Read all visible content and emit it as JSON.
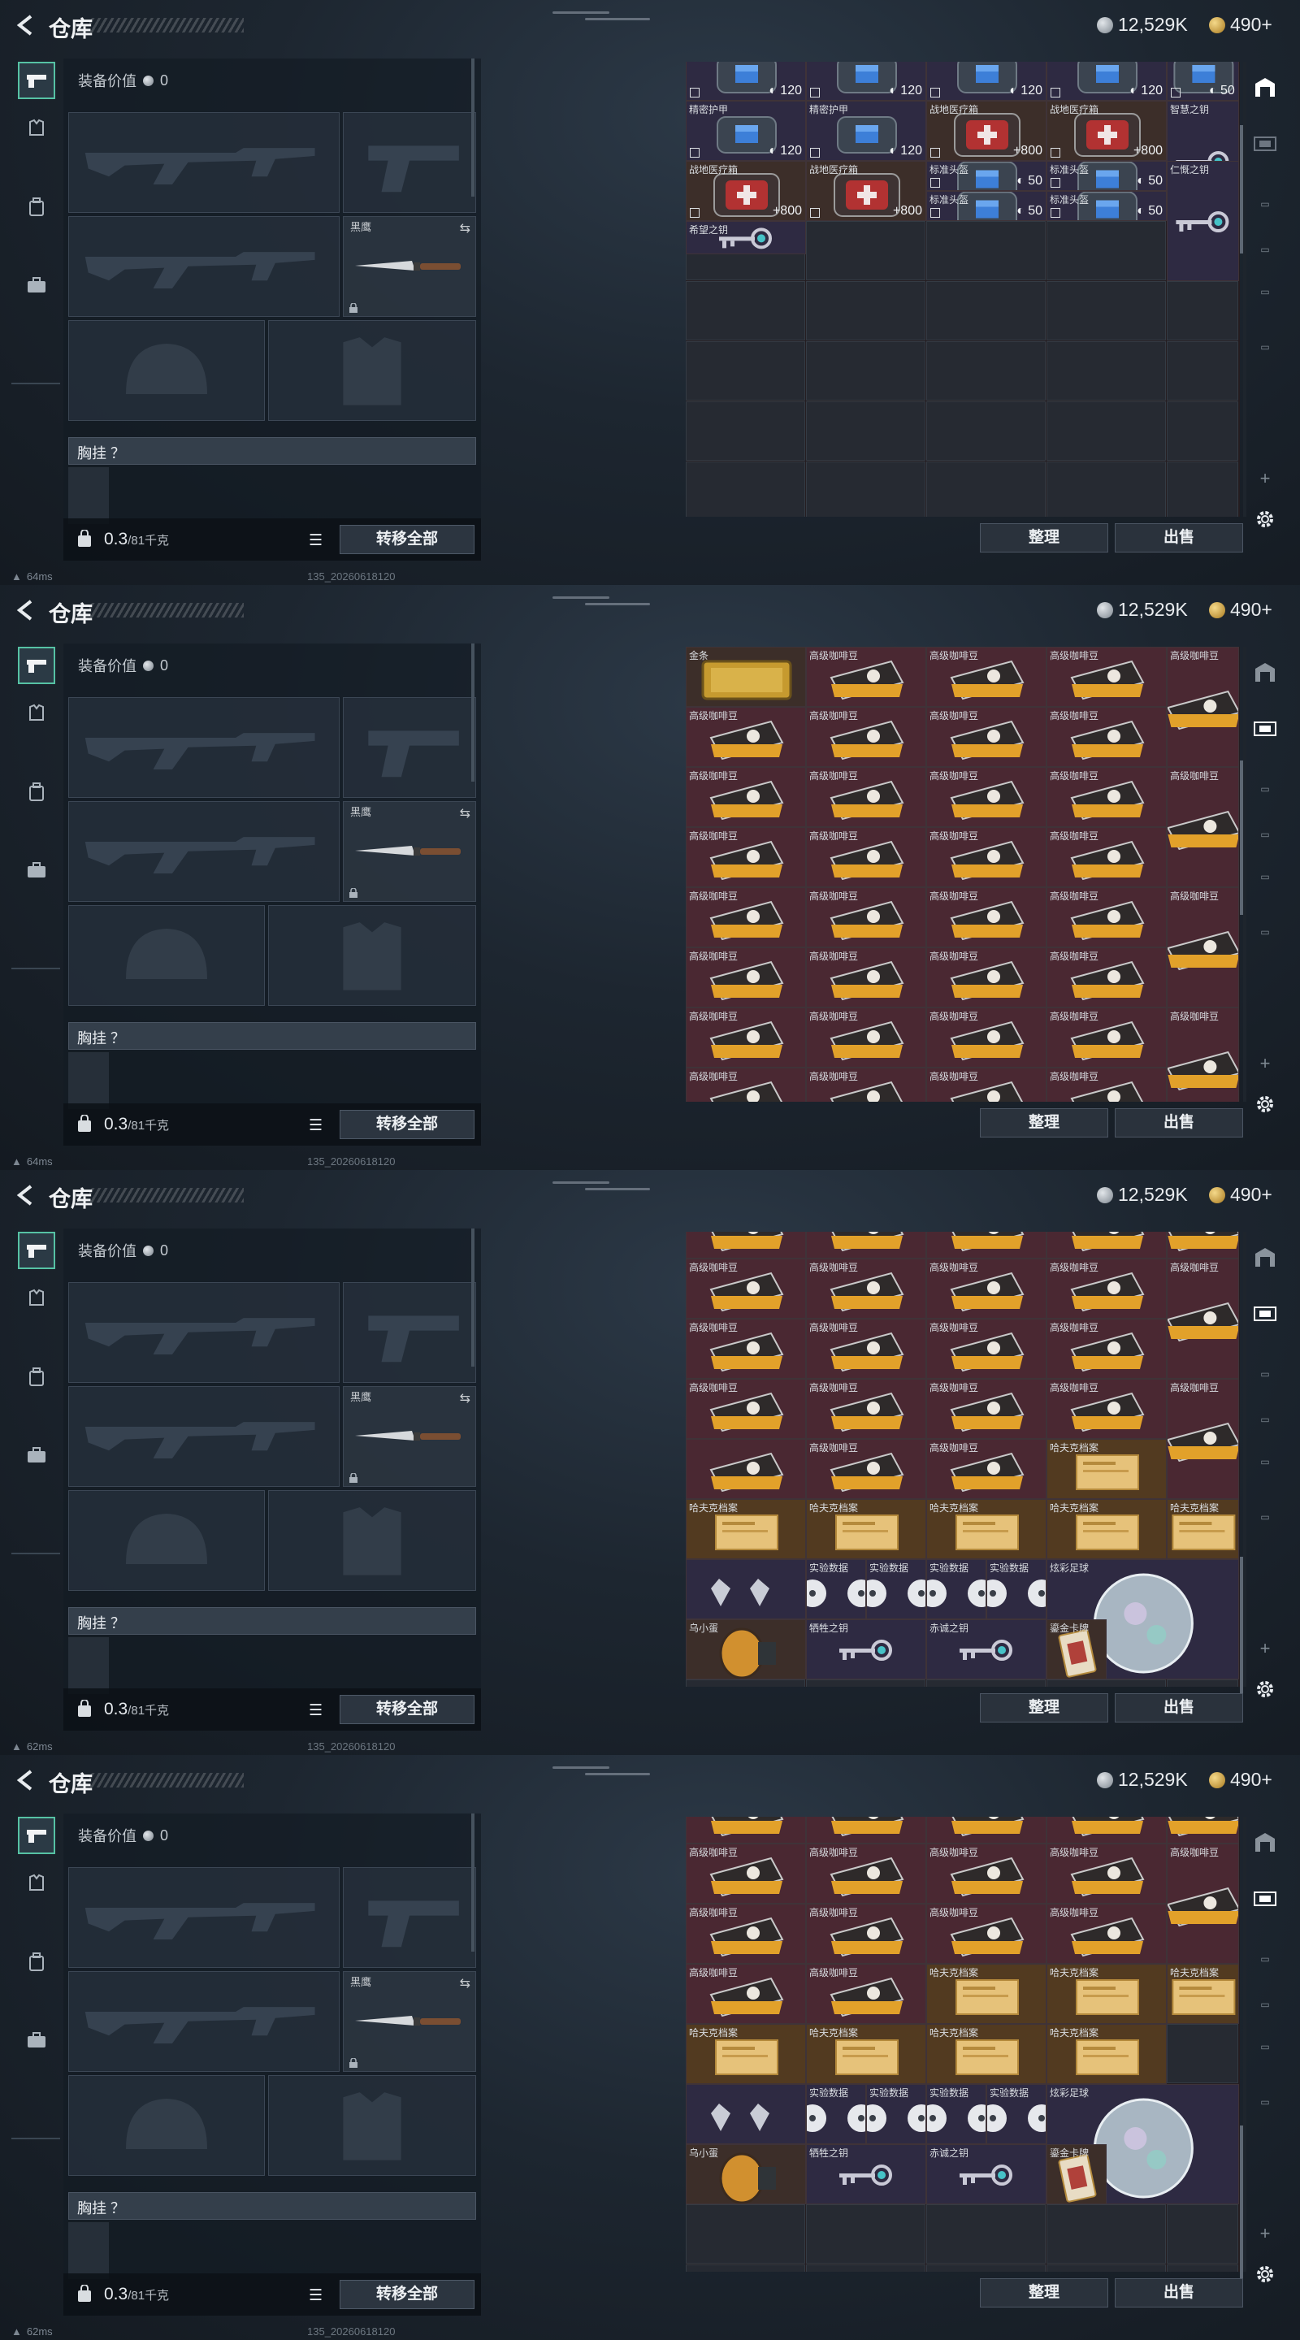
{
  "app": {
    "title": "仓库",
    "currency_silver": "12,529K",
    "currency_gold": "490+",
    "equipment_value_label": "装备价值",
    "equipment_value": "0",
    "knife_label": "黑鹰",
    "chest_rig_label": "胸挂 ？",
    "weight_value": "0.3",
    "weight_unit": "/81千克",
    "transfer_all_label": "转移全部",
    "sort_label": "整理",
    "sell_label": "出售",
    "build_id": "135_20260618120"
  },
  "colors": {
    "accent": "#56c2a4",
    "cell_purple": "#2e2a42",
    "cell_brown": "#3c2e29",
    "cell_maroon": "#4a2832",
    "cell_amber": "#523a20",
    "cell_dark": "#232a34"
  },
  "panels": [
    {
      "ping": "64ms",
      "cells": [
        {
          "label": "",
          "value": "120",
          "kind": "shield",
          "icon": "armor-case-icon"
        },
        {
          "label": "",
          "value": "120",
          "kind": "shield",
          "icon": "armor-case-icon"
        },
        {
          "label": "",
          "value": "120",
          "kind": "shield",
          "icon": "armor-case-icon"
        },
        {
          "label": "",
          "value": "120",
          "kind": "shield",
          "icon": "armor-case-icon"
        },
        {
          "label": "",
          "value": "50",
          "kind": "shield",
          "icon": "helmet-case-icon"
        },
        {
          "label": "精密护甲",
          "value": "120",
          "kind": "shield",
          "icon": "armor-case-icon"
        },
        {
          "label": "精密护甲",
          "value": "120",
          "kind": "shield",
          "icon": "armor-case-icon"
        },
        {
          "label": "战地医疗箱",
          "value": "+800",
          "kind": "heal",
          "icon": "medkit-icon"
        },
        {
          "label": "战地医疗箱",
          "value": "+800",
          "kind": "heal",
          "icon": "medkit-icon"
        },
        {
          "label": "智慧之钥",
          "value": "",
          "kind": "key",
          "icon": "key-icon"
        },
        {
          "label": "战地医疗箱",
          "value": "+800",
          "kind": "heal",
          "icon": "medkit-icon"
        },
        {
          "label": "战地医疗箱",
          "value": "+800",
          "kind": "heal",
          "icon": "medkit-icon"
        },
        {
          "label": "标准头盔",
          "value": "50",
          "kind": "shield",
          "icon": "helmet-case-icon"
        },
        {
          "label": "标准头盔",
          "value": "50",
          "kind": "shield",
          "icon": "helmet-case-icon"
        },
        {
          "label": "仁慨之钥",
          "value": "",
          "kind": "key",
          "icon": "key-icon"
        },
        {
          "label": "标准头盔",
          "value": "50",
          "kind": "shield",
          "icon": "helmet-case-icon"
        },
        {
          "label": "标准头盔",
          "value": "50",
          "kind": "shield",
          "icon": "helmet-case-icon"
        },
        {
          "label": "希望之钥",
          "value": "",
          "kind": "key",
          "icon": "key-icon"
        }
      ]
    },
    {
      "ping": "64ms",
      "cells": [
        {
          "label": "金条",
          "value": "",
          "kind": "gold",
          "icon": "gold-bar-icon"
        },
        {
          "label": "高级咖啡豆",
          "value": "",
          "kind": "coffee",
          "icon": "coffee-box-icon"
        },
        {
          "label": "高级咖啡豆",
          "value": "",
          "kind": "coffee",
          "icon": "coffee-box-icon"
        },
        {
          "label": "高级咖啡豆",
          "value": "",
          "kind": "coffee",
          "icon": "coffee-box-icon"
        },
        {
          "label": "高级咖啡豆",
          "value": "",
          "kind": "coffee",
          "icon": "coffee-bag-icon"
        },
        {
          "label": "高级咖啡豆",
          "value": "",
          "kind": "coffee",
          "icon": "coffee-box-icon"
        },
        {
          "label": "高级咖啡豆",
          "value": "",
          "kind": "coffee",
          "icon": "coffee-box-icon"
        },
        {
          "label": "高级咖啡豆",
          "value": "",
          "kind": "coffee",
          "icon": "coffee-box-icon"
        },
        {
          "label": "高级咖啡豆",
          "value": "",
          "kind": "coffee",
          "icon": "coffee-box-icon"
        },
        {
          "label": "高级咖啡豆",
          "value": "",
          "kind": "coffee",
          "icon": "coffee-box-icon"
        },
        {
          "label": "高级咖啡豆",
          "value": "",
          "kind": "coffee",
          "icon": "coffee-box-icon"
        },
        {
          "label": "高级咖啡豆",
          "value": "",
          "kind": "coffee",
          "icon": "coffee-box-icon"
        },
        {
          "label": "高级咖啡豆",
          "value": "",
          "kind": "coffee",
          "icon": "coffee-box-icon"
        },
        {
          "label": "高级咖啡豆",
          "value": "",
          "kind": "coffee",
          "icon": "coffee-bag-icon"
        },
        {
          "label": "高级咖啡豆",
          "value": "",
          "kind": "coffee",
          "icon": "coffee-box-icon"
        },
        {
          "label": "高级咖啡豆",
          "value": "",
          "kind": "coffee",
          "icon": "coffee-box-icon"
        },
        {
          "label": "高级咖啡豆",
          "value": "",
          "kind": "coffee",
          "icon": "coffee-box-icon"
        },
        {
          "label": "高级咖啡豆",
          "value": "",
          "kind": "coffee",
          "icon": "coffee-box-icon"
        },
        {
          "label": "高级咖啡豆",
          "value": "",
          "kind": "coffee",
          "icon": "coffee-box-icon"
        },
        {
          "label": "高级咖啡豆",
          "value": "",
          "kind": "coffee",
          "icon": "coffee-box-icon"
        },
        {
          "label": "高级咖啡豆",
          "value": "",
          "kind": "coffee",
          "icon": "coffee-box-icon"
        },
        {
          "label": "高级咖啡豆",
          "value": "",
          "kind": "coffee",
          "icon": "coffee-box-icon"
        },
        {
          "label": "高级咖啡豆",
          "value": "",
          "kind": "coffee",
          "icon": "coffee-bag-icon"
        },
        {
          "label": "高级咖啡豆",
          "value": "",
          "kind": "coffee",
          "icon": "coffee-box-icon"
        },
        {
          "label": "高级咖啡豆",
          "value": "",
          "kind": "coffee",
          "icon": "coffee-box-icon"
        },
        {
          "label": "高级咖啡豆",
          "value": "",
          "kind": "coffee",
          "icon": "coffee-box-icon"
        },
        {
          "label": "高级咖啡豆",
          "value": "",
          "kind": "coffee",
          "icon": "coffee-box-icon"
        },
        {
          "label": "高级咖啡豆",
          "value": "",
          "kind": "coffee",
          "icon": "coffee-box-icon"
        },
        {
          "label": "高级咖啡豆",
          "value": "",
          "kind": "coffee",
          "icon": "coffee-box-icon"
        },
        {
          "label": "高级咖啡豆",
          "value": "",
          "kind": "coffee",
          "icon": "coffee-box-icon"
        },
        {
          "label": "高级咖啡豆",
          "value": "",
          "kind": "coffee",
          "icon": "coffee-bag-icon"
        },
        {
          "label": "高级咖啡豆",
          "value": "",
          "kind": "coffee",
          "icon": "coffee-box-icon"
        },
        {
          "label": "高级咖啡豆",
          "value": "",
          "kind": "coffee",
          "icon": "coffee-box-icon"
        },
        {
          "label": "高级咖啡豆",
          "value": "",
          "kind": "coffee",
          "icon": "coffee-box-icon"
        },
        {
          "label": "高级咖啡豆",
          "value": "",
          "kind": "coffee",
          "icon": "coffee-box-icon"
        },
        {
          "label": "高级咖啡豆",
          "value": "",
          "kind": "coffee",
          "icon": "coffee-box-icon"
        },
        {
          "label": "高级咖啡豆",
          "value": "",
          "kind": "coffee",
          "icon": "coffee-box-icon"
        },
        {
          "label": "高级咖啡豆",
          "value": "",
          "kind": "coffee",
          "icon": "coffee-box-icon"
        },
        {
          "label": "高级咖啡豆",
          "value": "",
          "kind": "coffee",
          "icon": "coffee-box-icon"
        }
      ]
    },
    {
      "ping": "62ms",
      "cells": [
        {
          "label": "",
          "value": "",
          "kind": "coffee",
          "icon": "coffee-box-icon"
        },
        {
          "label": "",
          "value": "",
          "kind": "coffee",
          "icon": "coffee-box-icon"
        },
        {
          "label": "",
          "value": "",
          "kind": "coffee",
          "icon": "coffee-box-icon"
        },
        {
          "label": "",
          "value": "",
          "kind": "coffee",
          "icon": "coffee-box-icon"
        },
        {
          "label": "",
          "value": "",
          "kind": "coffee",
          "icon": "coffee-bag-icon"
        },
        {
          "label": "高级咖啡豆",
          "value": "",
          "kind": "coffee",
          "icon": "coffee-box-icon"
        },
        {
          "label": "高级咖啡豆",
          "value": "",
          "kind": "coffee",
          "icon": "coffee-box-icon"
        },
        {
          "label": "高级咖啡豆",
          "value": "",
          "kind": "coffee",
          "icon": "coffee-box-icon"
        },
        {
          "label": "高级咖啡豆",
          "value": "",
          "kind": "coffee",
          "icon": "coffee-box-icon"
        },
        {
          "label": "高级咖啡豆",
          "value": "",
          "kind": "coffee",
          "icon": "coffee-box-icon"
        },
        {
          "label": "高级咖啡豆",
          "value": "",
          "kind": "coffee",
          "icon": "coffee-box-icon"
        },
        {
          "label": "高级咖啡豆",
          "value": "",
          "kind": "coffee",
          "icon": "coffee-box-icon"
        },
        {
          "label": "高级咖啡豆",
          "value": "",
          "kind": "coffee",
          "icon": "coffee-box-icon"
        },
        {
          "label": "高级咖啡豆",
          "value": "",
          "kind": "coffee",
          "icon": "coffee-box-icon"
        },
        {
          "label": "高级咖啡豆",
          "value": "",
          "kind": "coffee",
          "icon": "coffee-bag-icon"
        },
        {
          "label": "高级咖啡豆",
          "value": "",
          "kind": "coffee",
          "icon": "coffee-box-icon"
        },
        {
          "label": "高级咖啡豆",
          "value": "",
          "kind": "coffee",
          "icon": "coffee-box-icon"
        },
        {
          "label": "高级咖啡豆",
          "value": "",
          "kind": "coffee",
          "icon": "coffee-box-icon"
        },
        {
          "label": "高级咖啡豆",
          "value": "",
          "kind": "coffee",
          "icon": "coffee-box-icon"
        },
        {
          "label": "",
          "value": "",
          "kind": "coffee",
          "icon": "coffee-box-icon"
        },
        {
          "label": "高级咖啡豆",
          "value": "",
          "kind": "coffee",
          "icon": "coffee-box-icon"
        },
        {
          "label": "高级咖啡豆",
          "value": "",
          "kind": "coffee",
          "icon": "coffee-box-icon"
        },
        {
          "label": "哈夫克档案",
          "value": "",
          "kind": "file",
          "icon": "document-icon"
        },
        {
          "label": "哈夫克档案",
          "value": "",
          "kind": "file",
          "icon": "document-icon"
        },
        {
          "label": "哈夫克档案",
          "value": "",
          "kind": "file",
          "icon": "document-icon"
        },
        {
          "label": "哈夫克档案",
          "value": "",
          "kind": "file",
          "icon": "document-icon"
        },
        {
          "label": "哈夫克档案",
          "value": "",
          "kind": "file",
          "icon": "document-icon"
        },
        {
          "label": "哈夫克档案",
          "value": "",
          "kind": "file",
          "icon": "document-icon"
        },
        {
          "label": "哈夫克档案",
          "value": "",
          "kind": "file",
          "icon": "document-icon"
        },
        {
          "label": "",
          "value": "",
          "kind": "empty",
          "icon": ""
        },
        {
          "label": "",
          "value": "",
          "kind": "gem",
          "icon": "gem-icon"
        },
        {
          "label": "实验数据",
          "value": "",
          "kind": "disc",
          "icon": "disc-icon"
        },
        {
          "label": "实验数据",
          "value": "",
          "kind": "disc",
          "icon": "disc-icon"
        },
        {
          "label": "实验数据",
          "value": "",
          "kind": "disc",
          "icon": "disc-icon"
        },
        {
          "label": "实验数据",
          "value": "",
          "kind": "disc",
          "icon": "disc-icon"
        },
        {
          "label": "炫彩足球",
          "value": "",
          "kind": "ball",
          "icon": "football-icon"
        },
        {
          "label": "乌小蛋",
          "value": "",
          "kind": "egg",
          "icon": "egg-icon"
        },
        {
          "label": "牺牲之钥",
          "value": "",
          "kind": "key",
          "icon": "key-icon"
        },
        {
          "label": "赤诚之钥",
          "value": "",
          "kind": "key",
          "icon": "key-icon"
        },
        {
          "label": "鎏金卡牌",
          "value": "",
          "kind": "card",
          "icon": "card-icon"
        }
      ]
    },
    {
      "ping": "62ms",
      "cells": [
        {
          "label": "",
          "value": "",
          "kind": "coffee",
          "icon": "coffee-box-icon"
        },
        {
          "label": "",
          "value": "",
          "kind": "coffee",
          "icon": "coffee-box-icon"
        },
        {
          "label": "",
          "value": "",
          "kind": "coffee",
          "icon": "coffee-box-icon"
        },
        {
          "label": "",
          "value": "",
          "kind": "coffee",
          "icon": "coffee-box-icon"
        },
        {
          "label": "",
          "value": "",
          "kind": "coffee",
          "icon": "coffee-bag-icon"
        },
        {
          "label": "高级咖啡豆",
          "value": "",
          "kind": "coffee",
          "icon": "coffee-box-icon"
        },
        {
          "label": "高级咖啡豆",
          "value": "",
          "kind": "coffee",
          "icon": "coffee-box-icon"
        },
        {
          "label": "高级咖啡豆",
          "value": "",
          "kind": "coffee",
          "icon": "coffee-box-icon"
        },
        {
          "label": "高级咖啡豆",
          "value": "",
          "kind": "coffee",
          "icon": "coffee-box-icon"
        },
        {
          "label": "高级咖啡豆",
          "value": "",
          "kind": "coffee",
          "icon": "coffee-box-icon"
        },
        {
          "label": "高级咖啡豆",
          "value": "",
          "kind": "coffee",
          "icon": "coffee-box-icon"
        },
        {
          "label": "高级咖啡豆",
          "value": "",
          "kind": "coffee",
          "icon": "coffee-box-icon"
        },
        {
          "label": "高级咖啡豆",
          "value": "",
          "kind": "coffee",
          "icon": "coffee-box-icon"
        },
        {
          "label": "高级咖啡豆",
          "value": "",
          "kind": "coffee",
          "icon": "coffee-box-icon"
        },
        {
          "label": "高级咖啡豆",
          "value": "",
          "kind": "coffee",
          "icon": "coffee-bag-icon"
        },
        {
          "label": "高级咖啡豆",
          "value": "",
          "kind": "coffee",
          "icon": "coffee-box-icon"
        },
        {
          "label": "高级咖啡豆",
          "value": "",
          "kind": "coffee",
          "icon": "coffee-box-icon"
        },
        {
          "label": "哈夫克档案",
          "value": "",
          "kind": "file",
          "icon": "document-icon"
        },
        {
          "label": "哈夫克档案",
          "value": "",
          "kind": "file",
          "icon": "document-icon"
        },
        {
          "label": "哈夫克档案",
          "value": "",
          "kind": "file",
          "icon": "document-icon"
        },
        {
          "label": "哈夫克档案",
          "value": "",
          "kind": "file",
          "icon": "document-icon"
        },
        {
          "label": "哈夫克档案",
          "value": "",
          "kind": "file",
          "icon": "document-icon"
        },
        {
          "label": "哈夫克档案",
          "value": "",
          "kind": "file",
          "icon": "document-icon"
        },
        {
          "label": "哈夫克档案",
          "value": "",
          "kind": "file",
          "icon": "document-icon"
        },
        {
          "label": "",
          "value": "",
          "kind": "empty",
          "icon": ""
        },
        {
          "label": "",
          "value": "",
          "kind": "gem",
          "icon": "gem-icon"
        },
        {
          "label": "实验数据",
          "value": "",
          "kind": "disc",
          "icon": "disc-icon"
        },
        {
          "label": "实验数据",
          "value": "",
          "kind": "disc",
          "icon": "disc-icon"
        },
        {
          "label": "实验数据",
          "value": "",
          "kind": "disc",
          "icon": "disc-icon"
        },
        {
          "label": "实验数据",
          "value": "",
          "kind": "disc",
          "icon": "disc-icon"
        },
        {
          "label": "炫彩足球",
          "value": "",
          "kind": "ball",
          "icon": "football-icon"
        },
        {
          "label": "乌小蛋",
          "value": "",
          "kind": "egg",
          "icon": "egg-icon"
        },
        {
          "label": "牺牲之钥",
          "value": "",
          "kind": "key",
          "icon": "key-icon"
        },
        {
          "label": "赤诚之钥",
          "value": "",
          "kind": "key",
          "icon": "key-icon"
        },
        {
          "label": "",
          "value": "",
          "kind": "disc",
          "icon": "disc-icon"
        },
        {
          "label": "鎏金卡牌",
          "value": "",
          "kind": "card",
          "icon": "card-icon"
        }
      ]
    }
  ]
}
